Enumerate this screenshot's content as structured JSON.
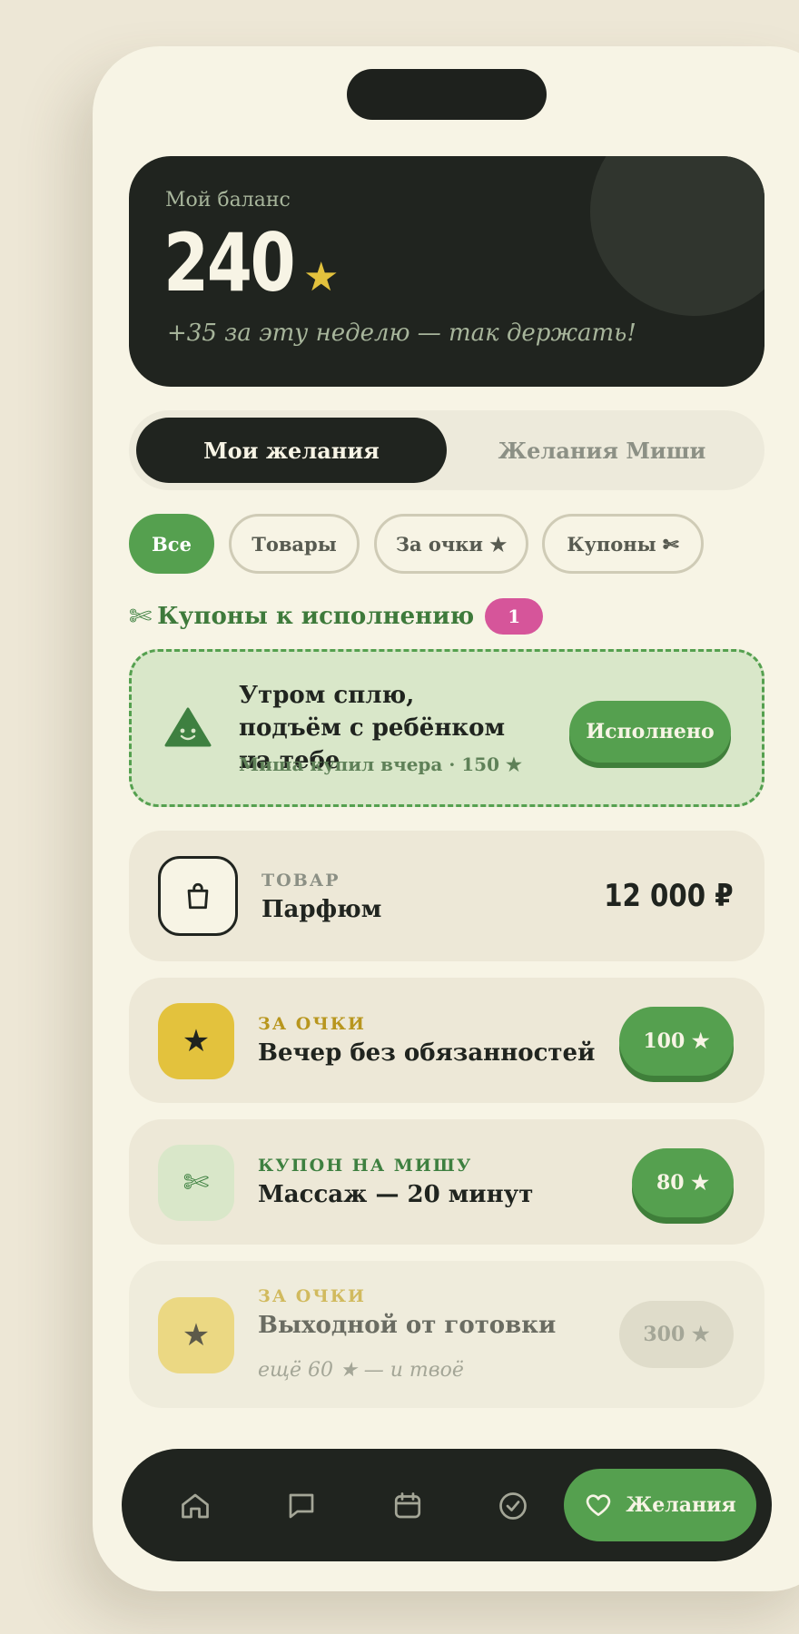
{
  "balance": {
    "label": "Мой баланс",
    "amount": "240",
    "star": "★",
    "note": "+35 за эту неделю — так держать!"
  },
  "tabs": [
    {
      "label": "Мои желания",
      "active": true
    },
    {
      "label": "Желания Миши",
      "active": false
    }
  ],
  "filters": [
    {
      "label": "Все",
      "active": true
    },
    {
      "label": "Товары",
      "active": false
    },
    {
      "label": "За очки ★",
      "active": false
    },
    {
      "label": "Купоны ✄",
      "active": false
    }
  ],
  "coupons_section": {
    "icon": "scissors-icon",
    "title": "Купоны к исполнению",
    "count": "1"
  },
  "pending_coupon": {
    "title": "Утром сплю, подъём с ребёнком на тебе",
    "subtitle": "Миша купил вчера · 150 ★",
    "action": "Исполнено"
  },
  "wishes": [
    {
      "kicker": "ТОВАР",
      "name": "Парфюм",
      "price": "12 000 ₽",
      "icon": "shopping-bag-icon"
    },
    {
      "kicker": "ЗА ОЧКИ",
      "name": "Вечер без обязанностей",
      "price": "100 ★",
      "icon": "star-icon"
    },
    {
      "kicker": "КУПОН НА МИШУ",
      "name": "Массаж — 20 минут",
      "price": "80 ★",
      "icon": "scissors-icon"
    },
    {
      "kicker": "ЗА ОЧКИ",
      "name": "Выходной от готовки",
      "price": "300 ★",
      "hint": "ещё 60 ★ — и твоё",
      "icon": "star-icon",
      "locked": true
    }
  ],
  "nav": {
    "items": [
      "home-icon",
      "chat-icon",
      "calendar-icon",
      "check-circle-icon"
    ],
    "active_label": "Желания",
    "active_icon": "heart-icon"
  },
  "colors": {
    "background": "#ede7d6",
    "surface": "#f7f4e5",
    "dark": "#20241f",
    "green": "#55a04f",
    "gold": "#e3c23d",
    "pink": "#d6559a"
  }
}
